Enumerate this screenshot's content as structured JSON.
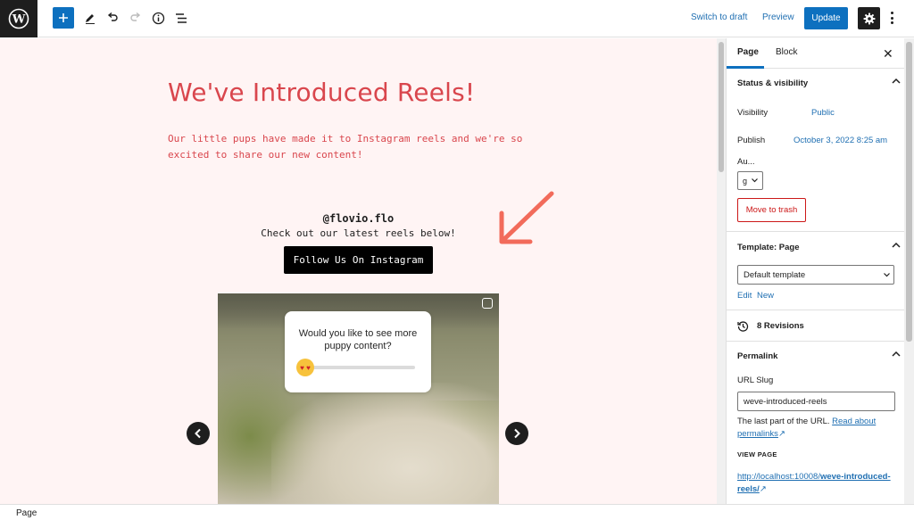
{
  "toolbar": {
    "switch_to_draft": "Switch to draft",
    "preview": "Preview",
    "update": "Update"
  },
  "content": {
    "title": "We've Introduced Reels!",
    "intro": "Our little pups have made it to Instagram reels and we're so excited to share our new content!",
    "handle": "@flovio.flo",
    "subtitle": "Check out our latest reels below!",
    "follow_button": "Follow Us On Instagram",
    "poll_question": "Would you like to see more puppy content?"
  },
  "sidebar": {
    "tabs": [
      "Page",
      "Block"
    ],
    "status_visibility": {
      "heading": "Status & visibility",
      "visibility_label": "Visibility",
      "visibility_value": "Public",
      "publish_label": "Publish",
      "publish_value": "October 3, 2022 8:25 am",
      "author_label": "Au...",
      "author_value": "g",
      "move_to_trash": "Move to trash"
    },
    "template": {
      "heading": "Template: Page",
      "selected": "Default template",
      "edit": "Edit",
      "new": "New"
    },
    "revisions": "8 Revisions",
    "permalink": {
      "heading": "Permalink",
      "slug_label": "URL Slug",
      "slug_value": "weve-introduced-reels",
      "help_text": "The last part of the URL.",
      "help_link": "Read about permalinks",
      "view_page_label": "VIEW PAGE",
      "url_prefix": "http://localhost:10008/",
      "url_slug": "weve-introduced-reels/"
    }
  },
  "footer": {
    "breadcrumb": "Page"
  },
  "colors": {
    "accent": "#0d70bf",
    "title_red": "#d9464d",
    "canvas_bg": "#fff4f4",
    "trash_red": "#cc1818"
  }
}
